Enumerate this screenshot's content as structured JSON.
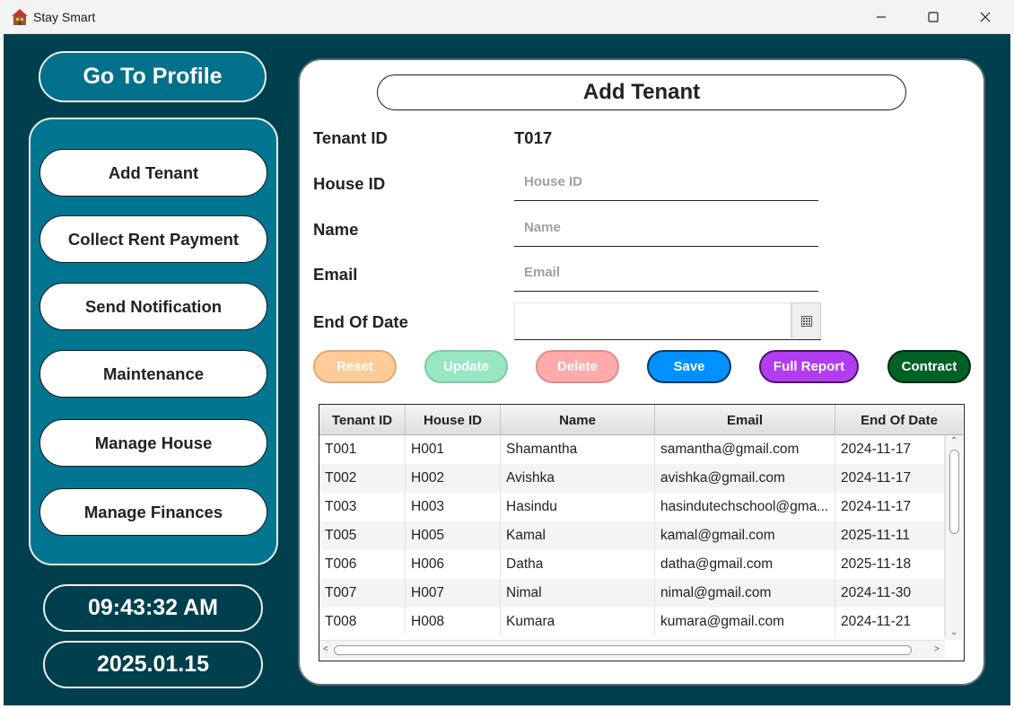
{
  "window": {
    "title": "Stay Smart"
  },
  "sidebar": {
    "profile_button": "Go To Profile",
    "nav_items": [
      {
        "label": "Add Tenant"
      },
      {
        "label": "Collect Rent Payment"
      },
      {
        "label": "Send Notification"
      },
      {
        "label": "Maintenance"
      },
      {
        "label": "Manage House"
      },
      {
        "label": "Manage Finances"
      }
    ],
    "time": "09:43:32 AM",
    "date": "2025.01.15"
  },
  "form": {
    "title": "Add Tenant",
    "tenant_id_label": "Tenant ID",
    "tenant_id_value": "T017",
    "house_id_label": "House ID",
    "house_id_placeholder": "House ID",
    "name_label": "Name",
    "name_placeholder": "Name",
    "email_label": "Email",
    "email_placeholder": "Email",
    "end_date_label": "End Of Date",
    "end_date_value": ""
  },
  "actions": [
    {
      "label": "Reset",
      "bg": "#ffcc99",
      "color": "#ffffff",
      "border": "#e0a878"
    },
    {
      "label": "Update",
      "bg": "#99e6c3",
      "color": "#ffffff",
      "border": "#7ccaa6"
    },
    {
      "label": "Delete",
      "bg": "#ffaaaa",
      "color": "#ffffff",
      "border": "#e08d8d"
    },
    {
      "label": "Save",
      "bg": "#0090ff",
      "color": "#ffffff",
      "border": "#0a3a66"
    },
    {
      "label": "Full Report",
      "bg": "#b23cf0",
      "color": "#ffffff",
      "border": "#4a1466"
    },
    {
      "label": "Contract",
      "bg": "#006127",
      "color": "#ffffff",
      "border": "#002a10"
    }
  ],
  "table": {
    "columns": [
      "Tenant ID",
      "House ID",
      "Name",
      "Email",
      "End Of Date"
    ],
    "rows": [
      [
        "T001",
        "H001",
        "Shamantha",
        "samantha@gmail.com",
        "2024-11-17"
      ],
      [
        "T002",
        "H002",
        "Avishka",
        "avishka@gmail.com",
        "2024-11-17"
      ],
      [
        "T003",
        "H003",
        "Hasindu",
        "hasindutechschool@gma...",
        "2024-11-17"
      ],
      [
        "T005",
        "H005",
        "Kamal",
        "kamal@gmail.com",
        "2025-11-11"
      ],
      [
        "T006",
        "H006",
        "Datha",
        "datha@gmail.com",
        "2025-11-18"
      ],
      [
        "T007",
        "H007",
        "Nimal",
        "nimal@gmail.com",
        "2024-11-30"
      ],
      [
        "T008",
        "H008",
        "Kumara",
        "kumara@gmail.com",
        "2024-11-21"
      ]
    ]
  },
  "colors": {
    "app_bg": "#003f4e",
    "panel_accent": "#027591",
    "profile_button": "#01718b"
  },
  "icons": {
    "app": "house-icon",
    "minimize": "minimize-icon",
    "maximize": "maximize-icon",
    "close": "close-icon",
    "calendar": "calendar-icon"
  }
}
